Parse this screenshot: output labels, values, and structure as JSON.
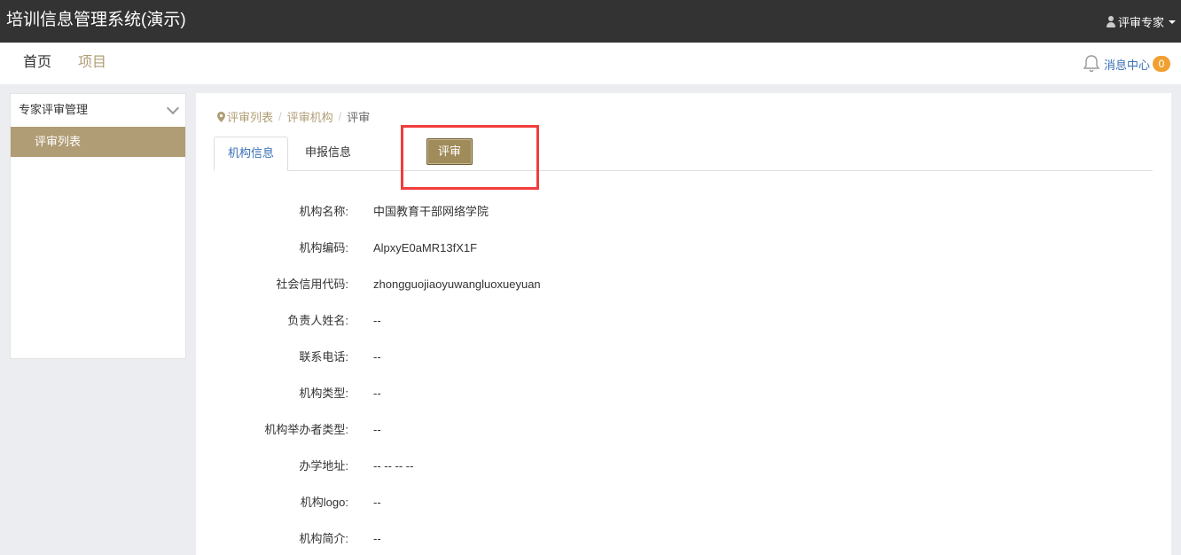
{
  "header": {
    "app_title": "培训信息管理系统(演示)",
    "user_label": "评审专家"
  },
  "nav": {
    "home": "首页",
    "project": "项目",
    "message_center": "消息中心",
    "message_count": "0"
  },
  "sidebar": {
    "group_title": "专家评审管理",
    "items": [
      {
        "label": "评审列表",
        "active": true
      }
    ]
  },
  "breadcrumb": {
    "items": [
      "评审列表",
      "评审机构"
    ],
    "current": "评审",
    "separator": "/"
  },
  "tabs": [
    {
      "label": "机构信息",
      "active": true
    },
    {
      "label": "申报信息",
      "active": false
    }
  ],
  "review_button": "评审",
  "fields": [
    {
      "label": "机构名称:",
      "value": "中国教育干部网络学院"
    },
    {
      "label": "机构编码:",
      "value": "AlpxyE0aMR13fX1F"
    },
    {
      "label": "社会信用代码:",
      "value": "zhongguojiaoyuwangluoxueyuan"
    },
    {
      "label": "负责人姓名:",
      "value": "--"
    },
    {
      "label": "联系电话:",
      "value": "--"
    },
    {
      "label": "机构类型:",
      "value": "--"
    },
    {
      "label": "机构举办者类型:",
      "value": "--"
    },
    {
      "label": "办学地址:",
      "value": "-- -- -- --"
    },
    {
      "label": "机构logo:",
      "value": "--"
    },
    {
      "label": "机构简介:",
      "value": "--"
    }
  ],
  "colors": {
    "topbar": "#333333",
    "accent": "#b09d75",
    "link": "#3a6fb5",
    "badge": "#f0a030",
    "highlight": "#f23c3c"
  }
}
